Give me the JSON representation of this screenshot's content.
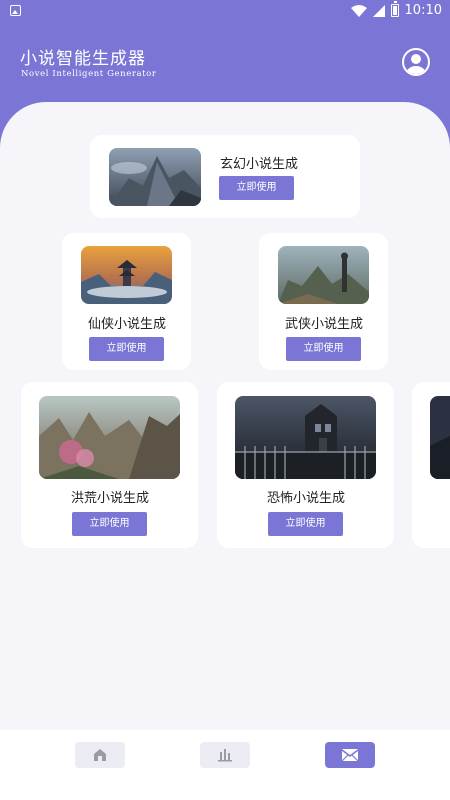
{
  "status_bar": {
    "time": "10:10"
  },
  "header": {
    "title": "小说智能生成器",
    "subtitle": "Novel Intelligent Generator"
  },
  "cards": [
    {
      "title": "玄幻小说生成",
      "button": "立即使用",
      "image": "fantasy-mountain-image"
    },
    {
      "title": "仙侠小说生成",
      "button": "立即使用",
      "image": "xianxia-pagoda-image"
    },
    {
      "title": "武侠小说生成",
      "button": "立即使用",
      "image": "wuxia-warrior-image"
    },
    {
      "title": "洪荒小说生成",
      "button": "立即使用",
      "image": "honghuang-landscape-image"
    },
    {
      "title": "恐怖小说生成",
      "button": "立即使用",
      "image": "horror-mansion-image"
    }
  ],
  "bottom_nav": [
    {
      "icon": "home-icon",
      "active": false
    },
    {
      "icon": "chart-icon",
      "active": false
    },
    {
      "icon": "mail-icon",
      "active": true
    }
  ],
  "colors": {
    "accent": "#7b76d6",
    "panel": "#f6f6fa",
    "nav_inactive": "#ececf4"
  }
}
